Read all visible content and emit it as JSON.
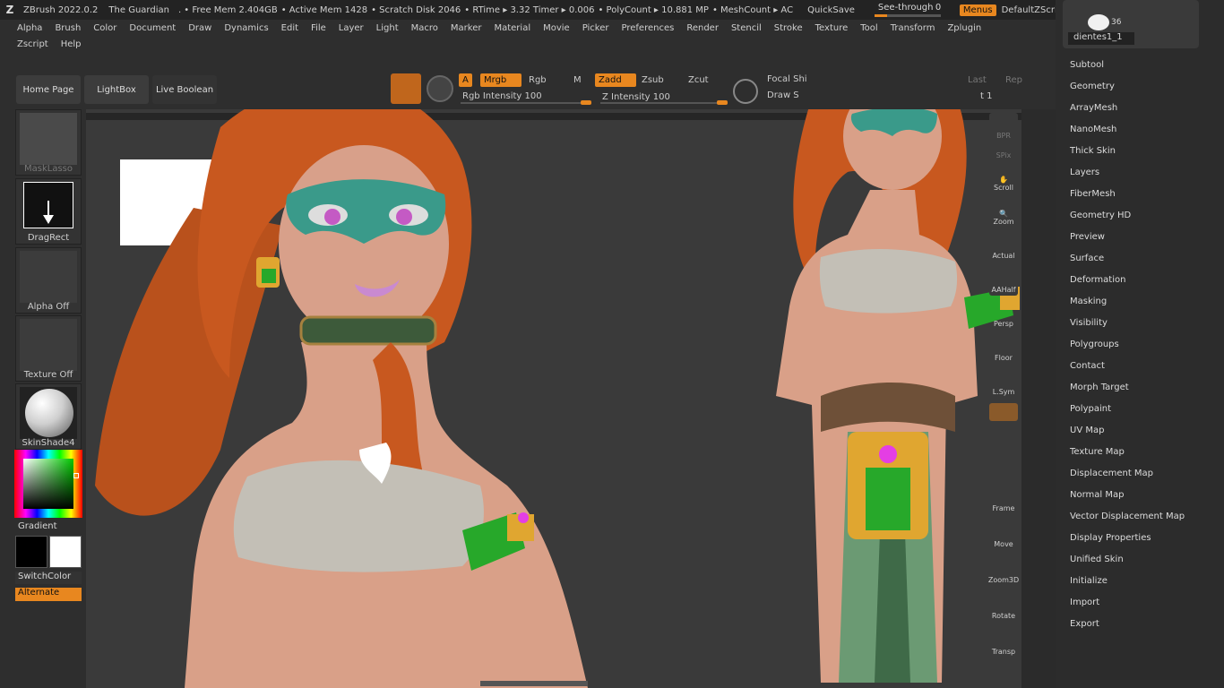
{
  "titlebar": {
    "app": "ZBrush 2022.0.2",
    "document": "The Guardian",
    "free_mem": ". • Free Mem 2.404GB",
    "active_mem": "• Active Mem 1428",
    "scratch": "• Scratch Disk 2046",
    "rtime": "• RTime ▸ 3.32 Timer ▸ 0.006",
    "polycount": "• PolyCount ▸ 10.881 MP",
    "meshcount": "• MeshCount ▸ AC",
    "quicksave": "QuickSave",
    "seethrough": "See-through",
    "seethrough_value": "0",
    "menus": "Menus",
    "script": "DefaultZScript"
  },
  "menubar": {
    "row1": [
      "Alpha",
      "Brush",
      "Color",
      "Document",
      "Draw",
      "Dynamics",
      "Edit",
      "File",
      "Layer",
      "Light",
      "Macro",
      "Marker",
      "Material",
      "Movie",
      "Picker",
      "Preferences",
      "Render",
      "Stencil",
      "Stroke",
      "Texture",
      "Tool",
      "Transform",
      "Zplugin"
    ],
    "row2": [
      "Zscript",
      "Help"
    ]
  },
  "shelf": {
    "home": "Home Page",
    "lightbox": "LightBox",
    "liveboolean": "Live Boolean",
    "a": "A",
    "mrgb": "Mrgb",
    "rgb": "Rgb",
    "m": "M",
    "zadd": "Zadd",
    "zsub": "Zsub",
    "zcut": "Zcut",
    "rgb_intensity": "Rgb Intensity 100",
    "z_intensity": "Z Intensity 100",
    "focal_shift": "Focal Shi",
    "draw_size": "Draw S",
    "last": "Last",
    "rep": "Rep",
    "last_value": "t 1",
    "rgb_intensity_value": 100,
    "z_intensity_value": 100
  },
  "lefttray": {
    "masklasso": "MaskLasso",
    "dragrect": "DragRect",
    "alpha": "Alpha Off",
    "texture": "Texture Off",
    "material": "SkinShade4",
    "gradient": "Gradient",
    "switchcolor": "SwitchColor",
    "alternate": "Alternate"
  },
  "rightshelf": [
    "BPR",
    "SPix",
    "Scroll",
    "Zoom",
    "Actual",
    "AAHalf",
    "Persp",
    "Floor",
    "L.Sym",
    "Frame",
    "Move",
    "Zoom3D",
    "Rotate",
    "Transp"
  ],
  "rightpanel": {
    "thumb_count": "36",
    "tool_name": "dientes1_1",
    "items": [
      "Subtool",
      "Geometry",
      "ArrayMesh",
      "NanoMesh",
      "Thick Skin",
      "Layers",
      "FiberMesh",
      "Geometry HD",
      "Preview",
      "Surface",
      "Deformation",
      "Masking",
      "Visibility",
      "Polygroups",
      "Contact",
      "Morph Target",
      "Polypaint",
      "UV Map",
      "Texture Map",
      "Displacement Map",
      "Normal Map",
      "Vector Displacement Map",
      "Display Properties",
      "Unified Skin",
      "Initialize",
      "Import",
      "Export"
    ]
  },
  "colors": {
    "accent": "#e8871f",
    "hair": "#c8581f",
    "skin": "#d9a088",
    "mask": "#3a9a8a",
    "jade": "#27a82a",
    "gold": "#e0a630"
  }
}
